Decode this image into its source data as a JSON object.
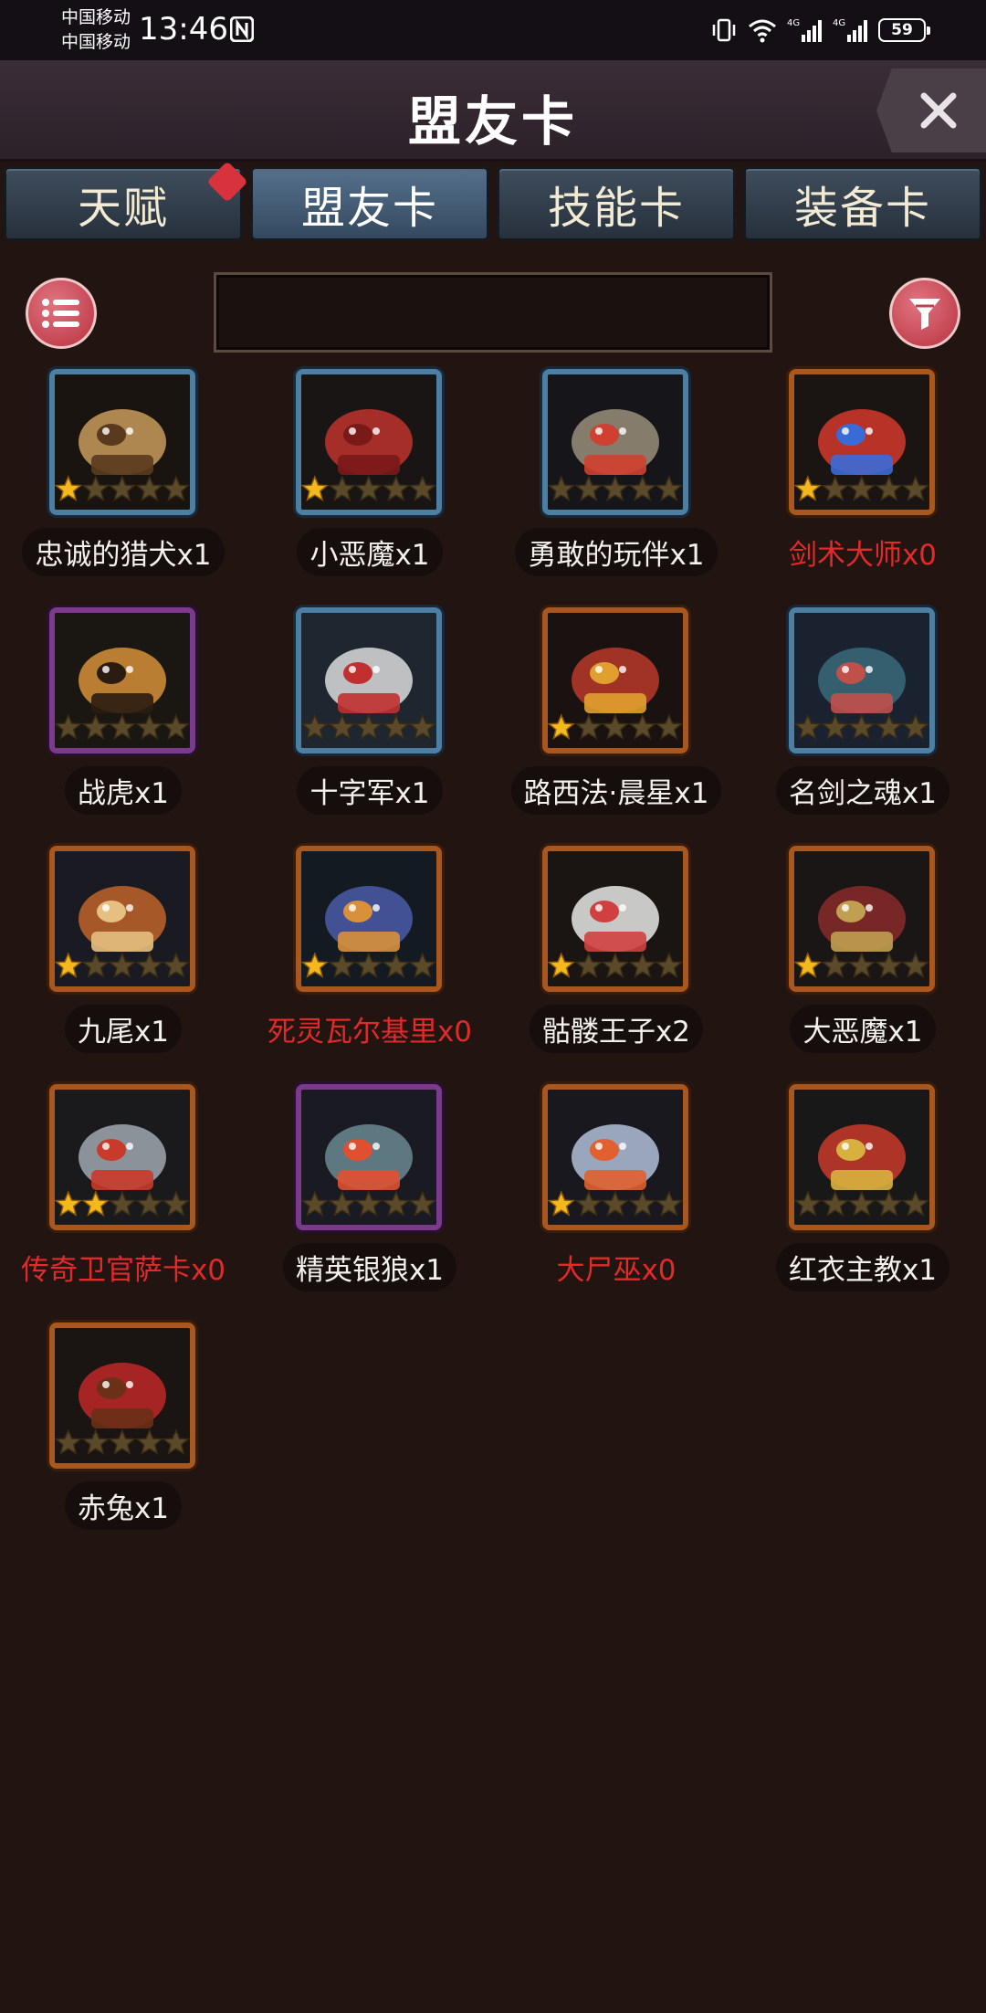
{
  "status_bar": {
    "carrier1": "中国移动",
    "carrier2": "中国移动",
    "time": "13:46",
    "battery": "59",
    "icons": [
      "nfc-icon",
      "vibrate-icon",
      "wifi-icon",
      "signal-4g-icon",
      "signal-4g-icon"
    ]
  },
  "header": {
    "title": "盟友卡",
    "close_icon": "close-icon"
  },
  "tabs": [
    {
      "label": "天赋",
      "active": false,
      "badge": true
    },
    {
      "label": "盟友卡",
      "active": true,
      "badge": false
    },
    {
      "label": "技能卡",
      "active": false,
      "badge": false
    },
    {
      "label": "装备卡",
      "active": false,
      "badge": false
    }
  ],
  "toolbar": {
    "list_icon": "list-icon",
    "filter_icon": "filter-icon",
    "search_value": ""
  },
  "cards": [
    {
      "name": "忠诚的猎犬x1",
      "stars": 1,
      "max_stars": 5,
      "rarity": "blue",
      "owned": true,
      "portrait": "hound"
    },
    {
      "name": "小恶魔x1",
      "stars": 1,
      "max_stars": 5,
      "rarity": "blue",
      "owned": true,
      "portrait": "imp"
    },
    {
      "name": "勇敢的玩伴x1",
      "stars": 0,
      "max_stars": 5,
      "rarity": "blue",
      "owned": true,
      "portrait": "helmet"
    },
    {
      "name": "剑术大师x0",
      "stars": 1,
      "max_stars": 5,
      "rarity": "orange",
      "owned": false,
      "portrait": "swordmaster"
    },
    {
      "name": "战虎x1",
      "stars": 0,
      "max_stars": 5,
      "rarity": "purple",
      "owned": true,
      "portrait": "tiger"
    },
    {
      "name": "十字军x1",
      "stars": 0,
      "max_stars": 5,
      "rarity": "blue",
      "owned": true,
      "portrait": "crusader"
    },
    {
      "name": "路西法·晨星x1",
      "stars": 1,
      "max_stars": 5,
      "rarity": "orange",
      "owned": true,
      "portrait": "lucifer"
    },
    {
      "name": "名剑之魂x1",
      "stars": 0,
      "max_stars": 5,
      "rarity": "blue",
      "owned": true,
      "portrait": "sword-soul"
    },
    {
      "name": "九尾x1",
      "stars": 1,
      "max_stars": 5,
      "rarity": "orange",
      "owned": true,
      "portrait": "nine-tails"
    },
    {
      "name": "死灵瓦尔基里x0",
      "stars": 1,
      "max_stars": 5,
      "rarity": "orange",
      "owned": false,
      "portrait": "valkyrie"
    },
    {
      "name": "骷髅王子x2",
      "stars": 1,
      "max_stars": 5,
      "rarity": "orange",
      "owned": true,
      "portrait": "skeleton"
    },
    {
      "name": "大恶魔x1",
      "stars": 1,
      "max_stars": 5,
      "rarity": "orange",
      "owned": true,
      "portrait": "demon"
    },
    {
      "name": "传奇卫官萨卡x0",
      "stars": 2,
      "max_stars": 5,
      "rarity": "orange",
      "owned": false,
      "portrait": "knight"
    },
    {
      "name": "精英银狼x1",
      "stars": 0,
      "max_stars": 5,
      "rarity": "purple",
      "owned": true,
      "portrait": "wolf"
    },
    {
      "name": "大尸巫x0",
      "stars": 1,
      "max_stars": 5,
      "rarity": "orange",
      "owned": false,
      "portrait": "lich"
    },
    {
      "name": "红衣主教x1",
      "stars": 0,
      "max_stars": 5,
      "rarity": "orange",
      "owned": true,
      "portrait": "cardinal"
    },
    {
      "name": "赤兔x1",
      "stars": 0,
      "max_stars": 5,
      "rarity": "orange",
      "owned": true,
      "portrait": "horse"
    }
  ]
}
